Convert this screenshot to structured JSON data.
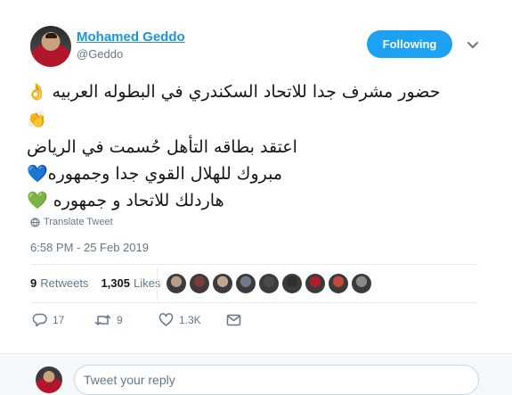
{
  "author": {
    "name": "Mohamed Geddo",
    "handle": "@Geddo"
  },
  "follow_button": {
    "label": "Following",
    "color": "#1da1f2"
  },
  "tweet": {
    "lines": [
      "حضور مشرف جدا للاتحاد السكندري في البطوله العربيه",
      "اعتقد بطاقه التأهل حُسمت في الرياض",
      "مبروك للهلال القوي جدا وجمهوره",
      "هاردلك للاتحاد و جمهوره"
    ],
    "emojis": {
      "ok_hand": "👌",
      "clap": "👏",
      "blue_heart": "💙",
      "green_heart": "💚"
    }
  },
  "translate_label": "Translate Tweet",
  "timestamp": "6:58 PM - 25 Feb 2019",
  "stats": {
    "retweets_count": "9",
    "retweets_label": "Retweets",
    "likes_count": "1,305",
    "likes_label": "Likes"
  },
  "likers": [
    "#b89c8a",
    "#7a3b3b",
    "#c2a58f",
    "#6e7b8c",
    "#4a4a4a",
    "#2f2f2f",
    "#b21d2b",
    "#c24a3a",
    "#8a8a8a"
  ],
  "actions": {
    "replies": "17",
    "retweets": "9",
    "likes": "1.3K"
  },
  "reply": {
    "placeholder": "Tweet your reply"
  }
}
